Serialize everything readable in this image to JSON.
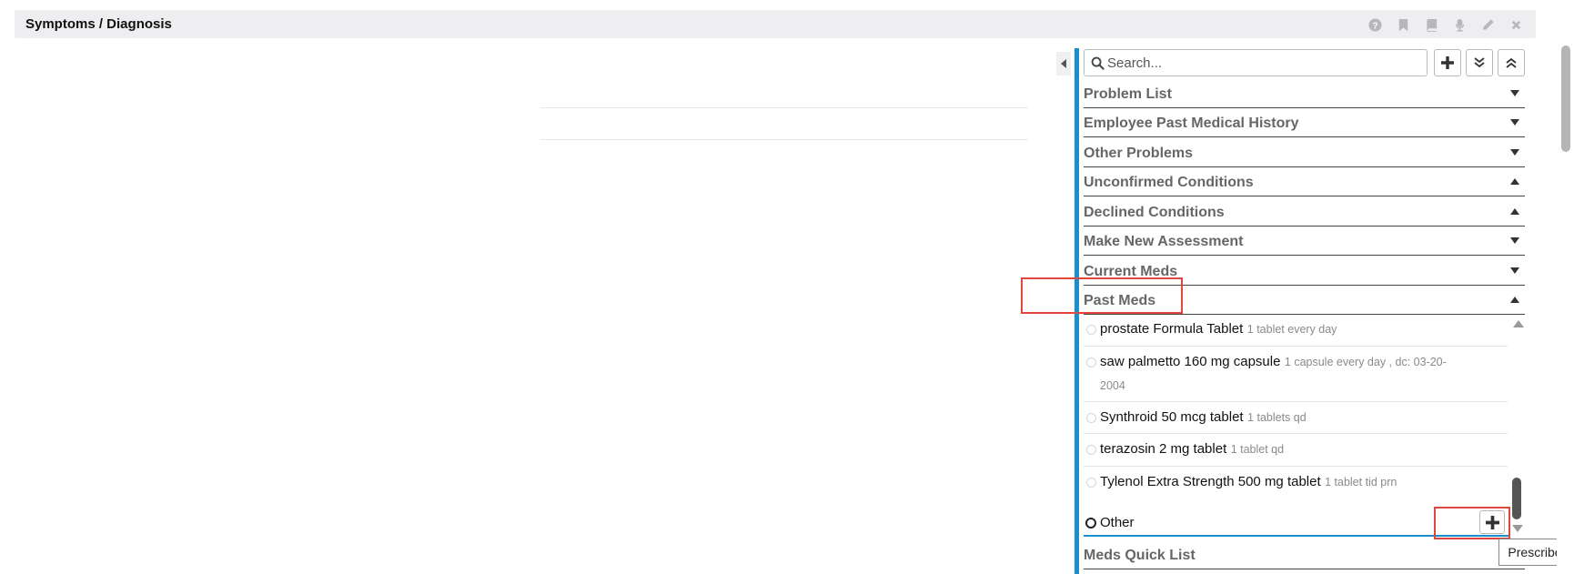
{
  "header": {
    "title": "Symptoms / Diagnosis",
    "tools": [
      "help-icon",
      "bookmark-icon",
      "book-icon",
      "microphone-icon",
      "pencil-icon",
      "close-icon"
    ]
  },
  "panel": {
    "accent_color": "#1a8fd0",
    "search": {
      "placeholder": "Search...",
      "value": ""
    },
    "sections": [
      {
        "label": "Problem List",
        "state": "collapsed"
      },
      {
        "label": "Employee Past Medical History",
        "state": "collapsed"
      },
      {
        "label": "Other Problems",
        "state": "collapsed"
      },
      {
        "label": "Unconfirmed Conditions",
        "state": "expanded"
      },
      {
        "label": "Declined Conditions",
        "state": "expanded"
      },
      {
        "label": "Make New Assessment",
        "state": "collapsed"
      },
      {
        "label": "Current Meds",
        "state": "collapsed"
      },
      {
        "label": "Past Meds",
        "state": "expanded"
      }
    ],
    "past_meds": [
      {
        "name": "prostate Formula Tablet",
        "sig": "1 tablet every day"
      },
      {
        "name": "saw palmetto 160 mg capsule",
        "sig": "1 capsule every day , dc: 03-20-2004"
      },
      {
        "name": "Synthroid 50 mcg tablet",
        "sig": "1 tablets qd"
      },
      {
        "name": "terazosin 2 mg tablet",
        "sig": "1 tablet qd"
      },
      {
        "name": "Tylenol Extra Strength 500 mg tablet",
        "sig": "1 tablet tid prn"
      }
    ],
    "other_label": "Other",
    "footer_section": {
      "label": "Meds Quick List"
    }
  },
  "tooltip": {
    "text": "Prescribe"
  },
  "highlight_color": "#e0463c"
}
